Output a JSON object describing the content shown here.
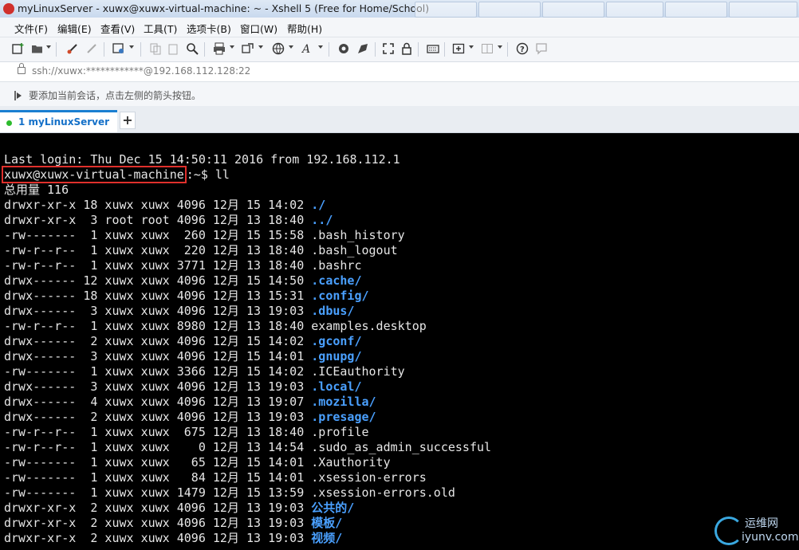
{
  "window": {
    "title": "myLinuxServer - xuwx@xuwx-virtual-machine: ~ - Xshell 5 (Free for Home/School)"
  },
  "menu": [
    "文件(F)",
    "编辑(E)",
    "查看(V)",
    "工具(T)",
    "选项卡(B)",
    "窗口(W)",
    "帮助(H)"
  ],
  "address": {
    "text": "ssh://xuwx:************@192.168.112.128:22"
  },
  "hint": {
    "text": "要添加当前会话，点击左侧的箭头按钮。"
  },
  "tabs": {
    "active_label": "1 myLinuxServer",
    "add_label": "+"
  },
  "terminal": {
    "last_login": "Last login: Thu Dec 15 14:50:11 2016 from 192.168.112.1",
    "prompt_user": "xuwx@xuwx-virtual-machine",
    "prompt_rest": ":~$ ll",
    "total": "总用量 116",
    "rows": [
      {
        "meta": "drwxr-xr-x 18 xuwx xuwx 4096 12月 15 14:02 ",
        "name": "./",
        "dir": true
      },
      {
        "meta": "drwxr-xr-x  3 root root 4096 12月 13 18:40 ",
        "name": "../",
        "dir": true
      },
      {
        "meta": "-rw-------  1 xuwx xuwx  260 12月 15 15:58 ",
        "name": ".bash_history",
        "dir": false
      },
      {
        "meta": "-rw-r--r--  1 xuwx xuwx  220 12月 13 18:40 ",
        "name": ".bash_logout",
        "dir": false
      },
      {
        "meta": "-rw-r--r--  1 xuwx xuwx 3771 12月 13 18:40 ",
        "name": ".bashrc",
        "dir": false
      },
      {
        "meta": "drwx------ 12 xuwx xuwx 4096 12月 15 14:50 ",
        "name": ".cache/",
        "dir": true
      },
      {
        "meta": "drwx------ 18 xuwx xuwx 4096 12月 13 15:31 ",
        "name": ".config/",
        "dir": true
      },
      {
        "meta": "drwx------  3 xuwx xuwx 4096 12月 13 19:03 ",
        "name": ".dbus/",
        "dir": true
      },
      {
        "meta": "-rw-r--r--  1 xuwx xuwx 8980 12月 13 18:40 ",
        "name": "examples.desktop",
        "dir": false
      },
      {
        "meta": "drwx------  2 xuwx xuwx 4096 12月 15 14:02 ",
        "name": ".gconf/",
        "dir": true
      },
      {
        "meta": "drwx------  3 xuwx xuwx 4096 12月 15 14:01 ",
        "name": ".gnupg/",
        "dir": true
      },
      {
        "meta": "-rw-------  1 xuwx xuwx 3366 12月 15 14:02 ",
        "name": ".ICEauthority",
        "dir": false
      },
      {
        "meta": "drwx------  3 xuwx xuwx 4096 12月 13 19:03 ",
        "name": ".local/",
        "dir": true
      },
      {
        "meta": "drwx------  4 xuwx xuwx 4096 12月 13 19:07 ",
        "name": ".mozilla/",
        "dir": true
      },
      {
        "meta": "drwx------  2 xuwx xuwx 4096 12月 13 19:03 ",
        "name": ".presage/",
        "dir": true
      },
      {
        "meta": "-rw-r--r--  1 xuwx xuwx  675 12月 13 18:40 ",
        "name": ".profile",
        "dir": false
      },
      {
        "meta": "-rw-r--r--  1 xuwx xuwx    0 12月 13 14:54 ",
        "name": ".sudo_as_admin_successful",
        "dir": false
      },
      {
        "meta": "-rw-------  1 xuwx xuwx   65 12月 15 14:01 ",
        "name": ".Xauthority",
        "dir": false
      },
      {
        "meta": "-rw-------  1 xuwx xuwx   84 12月 15 14:01 ",
        "name": ".xsession-errors",
        "dir": false
      },
      {
        "meta": "-rw-------  1 xuwx xuwx 1479 12月 15 13:59 ",
        "name": ".xsession-errors.old",
        "dir": false
      },
      {
        "meta": "drwxr-xr-x  2 xuwx xuwx 4096 12月 13 19:03 ",
        "name": "公共的/",
        "dir": true
      },
      {
        "meta": "drwxr-xr-x  2 xuwx xuwx 4096 12月 13 19:03 ",
        "name": "模板/",
        "dir": true
      },
      {
        "meta": "drwxr-xr-x  2 xuwx xuwx 4096 12月 13 19:03 ",
        "name": "视频/",
        "dir": true
      }
    ]
  },
  "watermark": {
    "line1": "运维网",
    "line2": "iyunv.com"
  },
  "colors": {
    "terminal_bg": "#000000",
    "terminal_fg": "#e6e6e6",
    "dir_color": "#4aa0ff",
    "highlight_box": "#e0302c",
    "tab_accent": "#1a7fd1",
    "session_dot": "#2dbb2d"
  }
}
